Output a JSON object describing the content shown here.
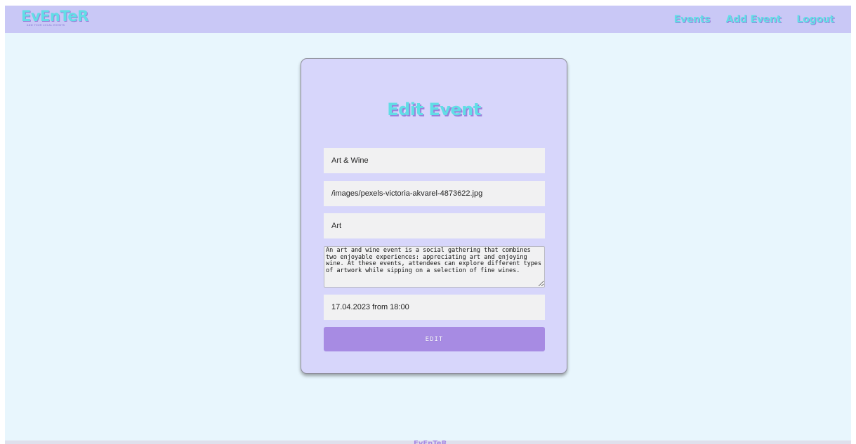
{
  "header": {
    "logo": "EvEnTeR",
    "tagline": "ADD YOUR LOCAL EVENTS",
    "nav": [
      {
        "label": "Events"
      },
      {
        "label": "Add Event"
      },
      {
        "label": "Logout"
      }
    ]
  },
  "form": {
    "title": "Edit Event",
    "title_value": "Art & Wine",
    "image_value": "/images/pexels-victoria-akvarel-4873622.jpg",
    "category_value": "Art",
    "description_value": "An art and wine event is a social gathering that combines two enjoyable experiences: appreciating art and enjoying wine. At these events, attendees can explore different types of artwork while sipping on a selection of fine wines.",
    "date_value": "17.04.2023 from 18:00",
    "submit_label": "EDIT"
  },
  "footer": {
    "logo": "EvEnTeR"
  },
  "colors": {
    "navbar": "#c9c8f6",
    "page_background": "#e8f6fd",
    "card_background": "#d7d6fb",
    "accent_text": "#62dde6",
    "accent_shadow": "#9a82db",
    "button": "#a78be3"
  }
}
